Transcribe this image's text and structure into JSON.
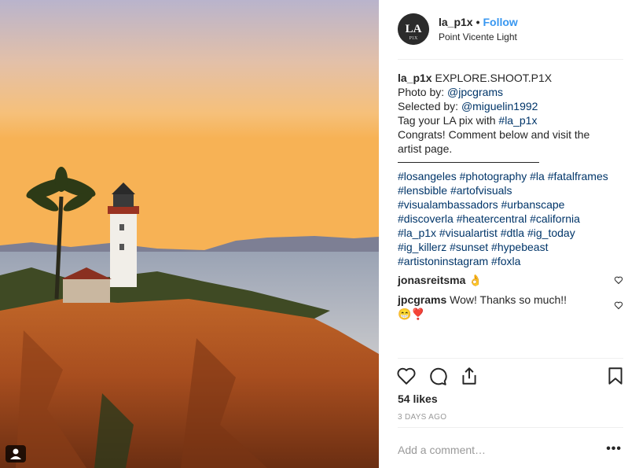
{
  "post": {
    "username": "la_p1x",
    "follow_label": "Follow",
    "location": "Point Vicente Light",
    "caption_lines": [
      {
        "user": "la_p1x",
        "text": " EXPLORE.SHOOT.P1X"
      },
      {
        "prefix": "Photo by: ",
        "link": "@jpcgrams"
      },
      {
        "prefix": "Selected by: ",
        "link": "@miguelin1992"
      },
      {
        "prefix": "Tag your LA pix with ",
        "link": "#la_p1x"
      },
      {
        "text": "Congrats! Comment below and visit the"
      },
      {
        "text": "artist page."
      }
    ],
    "hashtag_lines": [
      "#losangeles #photography #la #fatalframes",
      "#lensbible #artofvisuals",
      "#visualambassadors #urbanscape",
      "#discoverla #heatercentral #california",
      "#la_p1x #visualartist #dtla #ig_today",
      "#ig_killerz #sunset #hypebeast",
      "#artistoninstagram #foxla"
    ],
    "comments": [
      {
        "user": "jonasreitsma",
        "text": " 👌"
      },
      {
        "user": "jpcgrams",
        "text": " Wow! Thanks so much!!",
        "text2": "😁❣️"
      }
    ],
    "likes": "54 likes",
    "time_ago": "3 DAYS AGO",
    "add_comment_placeholder": "Add a comment…",
    "more_label": "•••"
  },
  "icons": {
    "like": "heart-icon",
    "comment": "comment-icon",
    "share": "share-icon",
    "save": "bookmark-icon",
    "tagged": "person-icon"
  },
  "colors": {
    "link": "#003569",
    "follow": "#3897f0",
    "muted": "#999999"
  }
}
